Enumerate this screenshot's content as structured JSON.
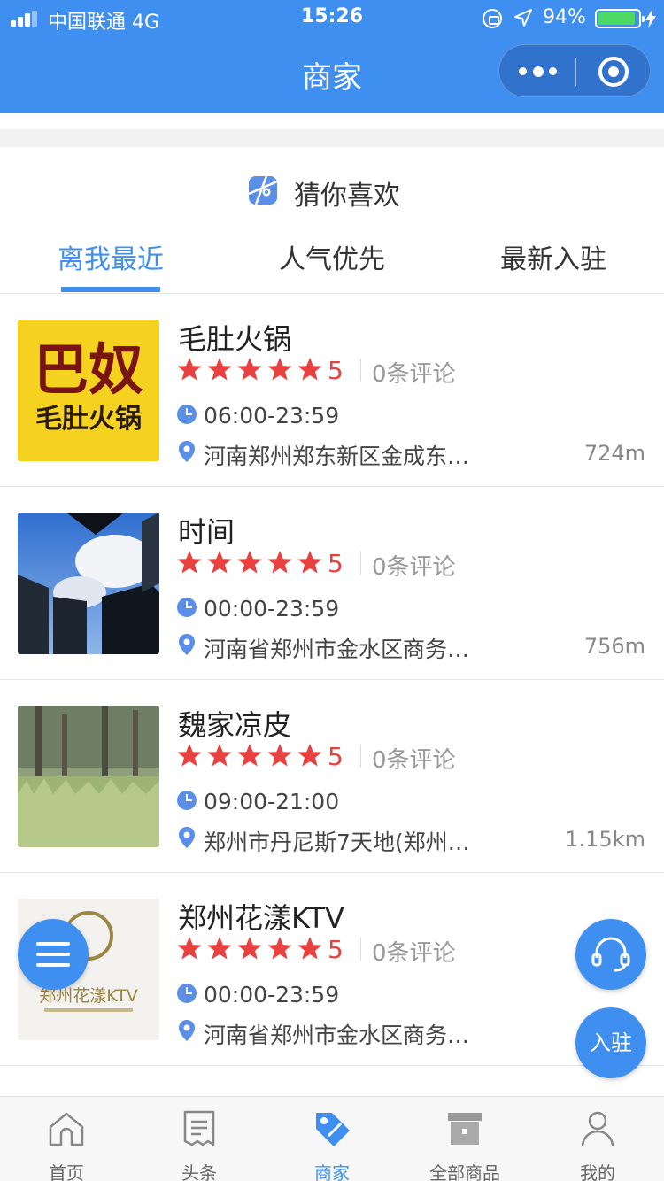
{
  "status_bar": {
    "carrier": "中国联通  4G",
    "time": "15:26",
    "battery": "94%",
    "battery_level": 0.94
  },
  "header": {
    "title": "商家"
  },
  "section": {
    "title": "猜你喜欢"
  },
  "tabs": [
    {
      "label": "离我最近",
      "active": true
    },
    {
      "label": "人气优先",
      "active": false
    },
    {
      "label": "最新入驻",
      "active": false
    }
  ],
  "merchants": [
    {
      "name": "毛肚火锅",
      "rating": 5,
      "score": "5",
      "reviews": "0条评论",
      "hours": "06:00-23:59",
      "address": "河南郑州郑东新区金成东…",
      "distance": "724m",
      "logo_text": {
        "line1": "巴奴",
        "line2": "毛肚火锅"
      }
    },
    {
      "name": "时间",
      "rating": 5,
      "score": "5",
      "reviews": "0条评论",
      "hours": "00:00-23:59",
      "address": "河南省郑州市金水区商务…",
      "distance": "756m"
    },
    {
      "name": "魏家凉皮",
      "rating": 5,
      "score": "5",
      "reviews": "0条评论",
      "hours": "09:00-21:00",
      "address": "郑州市丹尼斯7天地(郑州…",
      "distance": "1.15km"
    },
    {
      "name": "郑州花漾KTV",
      "rating": 5,
      "score": "5",
      "reviews": "0条评论",
      "hours": "00:00-23:59",
      "address": "河南省郑州市金水区商务…",
      "distance": "",
      "logo_text": {
        "line1": "郑州花漾KTV"
      }
    }
  ],
  "floating": {
    "join_label": "入驻"
  },
  "bottom_nav": [
    {
      "label": "首页",
      "icon": "home-icon",
      "active": false
    },
    {
      "label": "头条",
      "icon": "news-icon",
      "active": false
    },
    {
      "label": "商家",
      "icon": "merchant-tag-icon",
      "active": true
    },
    {
      "label": "全部商品",
      "icon": "box-icon",
      "active": false
    },
    {
      "label": "我的",
      "icon": "user-icon",
      "active": false
    }
  ],
  "colors": {
    "primary": "#3f8ff0",
    "star": "#e8413f",
    "battery": "#4cd964"
  }
}
